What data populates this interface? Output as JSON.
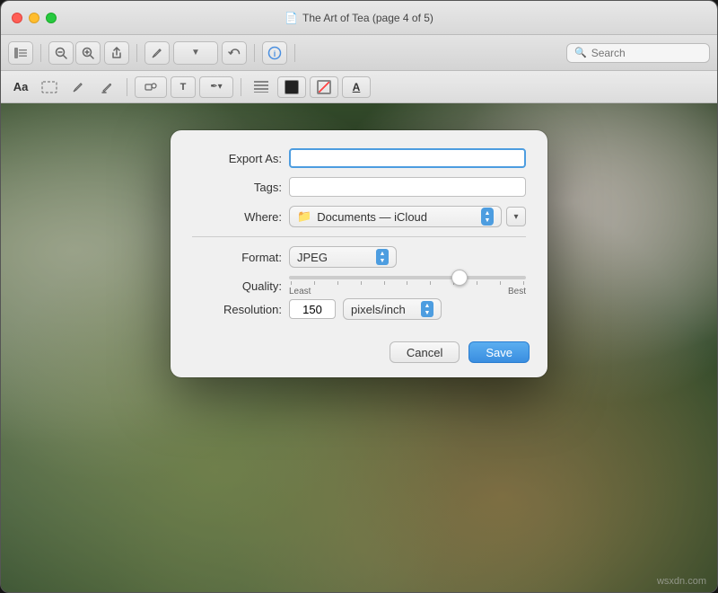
{
  "window": {
    "title": "The Art of Tea (page 4 of 5)",
    "doc_icon": "📄"
  },
  "toolbar": {
    "search_placeholder": "Search"
  },
  "dialog": {
    "export_as_label": "Export As:",
    "tags_label": "Tags:",
    "where_label": "Where:",
    "where_value": "Documents — iCloud",
    "format_label": "Format:",
    "format_value": "JPEG",
    "quality_label": "Quality:",
    "quality_min": "Least",
    "quality_max": "Best",
    "resolution_label": "Resolution:",
    "resolution_value": "150",
    "resolution_unit": "pixels/inch",
    "cancel_label": "Cancel",
    "save_label": "Save"
  },
  "watermark": {
    "text": "wsxdn.com"
  }
}
